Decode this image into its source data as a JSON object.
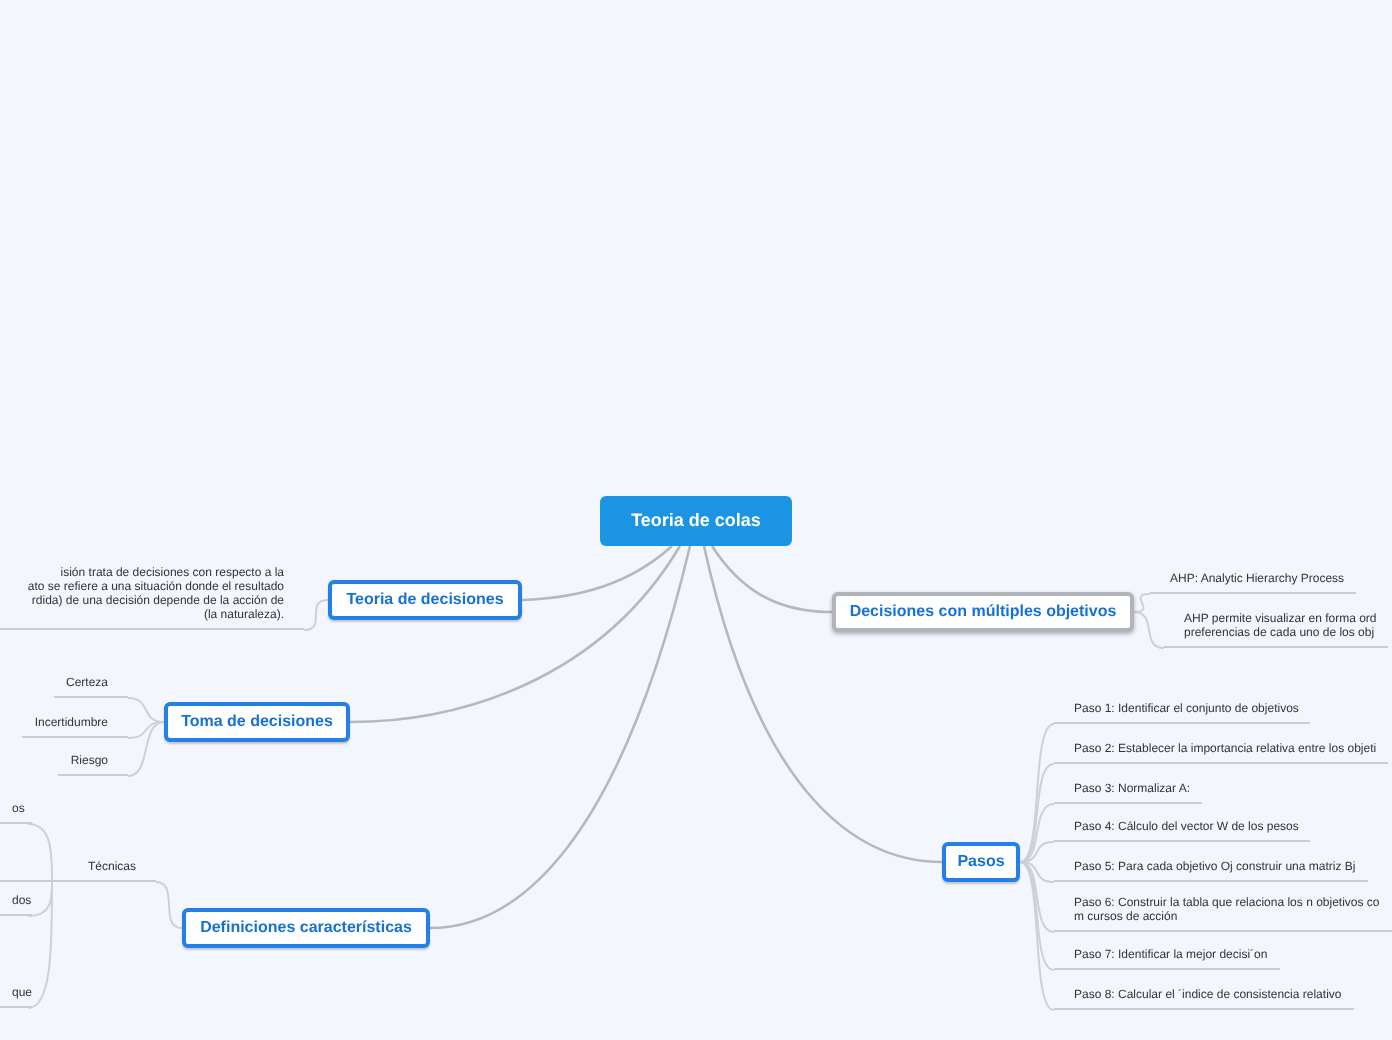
{
  "central": {
    "title": "Teoria de colas"
  },
  "branches": [
    {
      "title": "Teoria de decisiones",
      "selected": false,
      "children": [
        {
          "lines": [
            "isión trata de decisiones con respecto a la",
            "ato se refiere a una situación donde el resultado",
            "rdida) de una decisión depende de la acción de",
            "(la naturaleza)."
          ]
        }
      ]
    },
    {
      "title": "Toma de decisiones",
      "selected": false,
      "children": [
        {
          "text": "Certeza"
        },
        {
          "text": "Incertidumbre"
        },
        {
          "text": "Riesgo"
        }
      ]
    },
    {
      "title": "Definiciones características",
      "selected": false,
      "children": [
        {
          "text": "Técnicas",
          "children": [
            {
              "text": "os"
            },
            {
              "text": "dos"
            },
            {
              "text": "que"
            }
          ]
        }
      ]
    },
    {
      "title": "Decisiones con múltiples objetivos",
      "selected": true,
      "children": [
        {
          "text": "AHP: Analytic Hierarchy Process"
        },
        {
          "lines": [
            "AHP permite visualizar en forma ord",
            "preferencias de cada uno de los obj"
          ]
        }
      ]
    },
    {
      "title": "Pasos",
      "selected": false,
      "children": [
        {
          "text": "Paso 1: Identificar el conjunto de objetivos"
        },
        {
          "text": "Paso 2: Establecer la importancia relativa entre los objeti"
        },
        {
          "text": "Paso 3: Normalizar A:"
        },
        {
          "text": "Paso 4: Cálculo del vector W de los pesos"
        },
        {
          "text": "Paso 5: Para cada objetivo Oj construir una matriz Bj"
        },
        {
          "lines": [
            "Paso 6: Construir la tabla que relaciona los n objetivos co",
            "m cursos de acción"
          ]
        },
        {
          "text": "Paso 7: Identificar la mejor decisi´on"
        },
        {
          "text": "Paso 8: Calcular el ´indice de consistencia relativo"
        }
      ]
    }
  ]
}
